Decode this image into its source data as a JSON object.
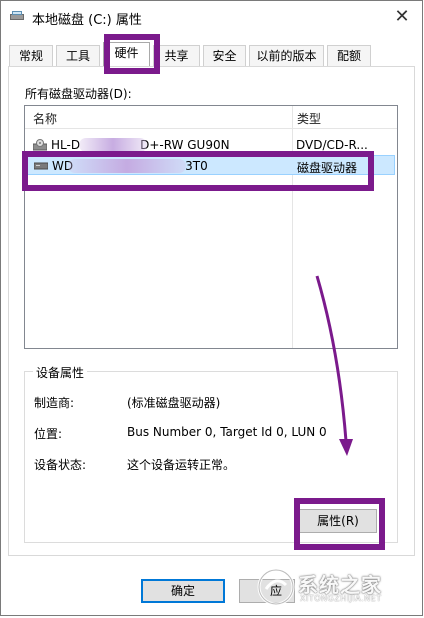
{
  "window": {
    "title": "本地磁盘 (C:) 属性",
    "close_glyph": "✕"
  },
  "tabs": [
    {
      "label": "常规",
      "active": false
    },
    {
      "label": "工具",
      "active": false
    },
    {
      "label": "硬件",
      "active": true
    },
    {
      "label": "共享",
      "active": false
    },
    {
      "label": "安全",
      "active": false
    },
    {
      "label": "以前的版本",
      "active": false
    },
    {
      "label": "配额",
      "active": false
    }
  ],
  "hardware": {
    "list_title": "所有磁盘驱动器(D):",
    "columns": {
      "name": "名称",
      "type": "类型"
    },
    "devices": [
      {
        "name_start": "HL-D",
        "name_end": "D+-RW GU90N",
        "type": "DVD/CD-R...",
        "icon": "dvd-drive-icon",
        "selected": false
      },
      {
        "name_start": "WD",
        "name_end": "3T0",
        "type": "磁盘驱动器",
        "icon": "hard-disk-icon",
        "selected": true
      }
    ]
  },
  "device_properties": {
    "group_title": "设备属性",
    "manufacturer_label": "制造商:",
    "manufacturer_value": "(标准磁盘驱动器)",
    "location_label": "位置:",
    "location_value": "Bus Number 0, Target Id 0, LUN 0",
    "status_label": "设备状态:",
    "status_value": "这个设备运转正常。",
    "properties_button": "属性(R)"
  },
  "footer": {
    "ok_button": "确定",
    "apply_button_visible": "应"
  },
  "watermark": {
    "text": "系统之家",
    "url": "XITONGZHIJIA.NET"
  },
  "colors": {
    "annotation": "#7b1a8c",
    "selection": "#cce8ff",
    "accent": "#0078d7"
  }
}
